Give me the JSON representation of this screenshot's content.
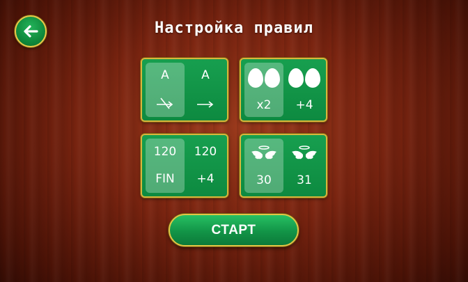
{
  "header": {
    "title": "Настройка правил",
    "back_icon": "arrow-left-icon"
  },
  "cards": [
    {
      "name": "ace-rule",
      "options": [
        {
          "top": "A",
          "bottom_icon": "arrow-crossed-icon",
          "selected": true
        },
        {
          "top": "A",
          "bottom_icon": "arrow-right-icon",
          "selected": false
        }
      ]
    },
    {
      "name": "eggs-rule",
      "options": [
        {
          "top_icon": "eggs-icon",
          "bottom": "x2",
          "selected": true
        },
        {
          "top_icon": "eggs-icon",
          "bottom": "+4",
          "selected": false
        }
      ]
    },
    {
      "name": "finish-rule",
      "options": [
        {
          "top": "120",
          "bottom": "FIN",
          "selected": true
        },
        {
          "top": "120",
          "bottom": "+4",
          "selected": false
        }
      ]
    },
    {
      "name": "wings-rule",
      "options": [
        {
          "top_icon": "angel-wings-icon",
          "bottom": "30",
          "selected": true
        },
        {
          "top_icon": "angel-wings-icon",
          "bottom": "31",
          "selected": false
        }
      ]
    }
  ],
  "start_button": {
    "label": "СТАРТ"
  },
  "colors": {
    "accent_green": "#129447",
    "gold_border": "#d9b53c",
    "wood": "#7a2410"
  }
}
